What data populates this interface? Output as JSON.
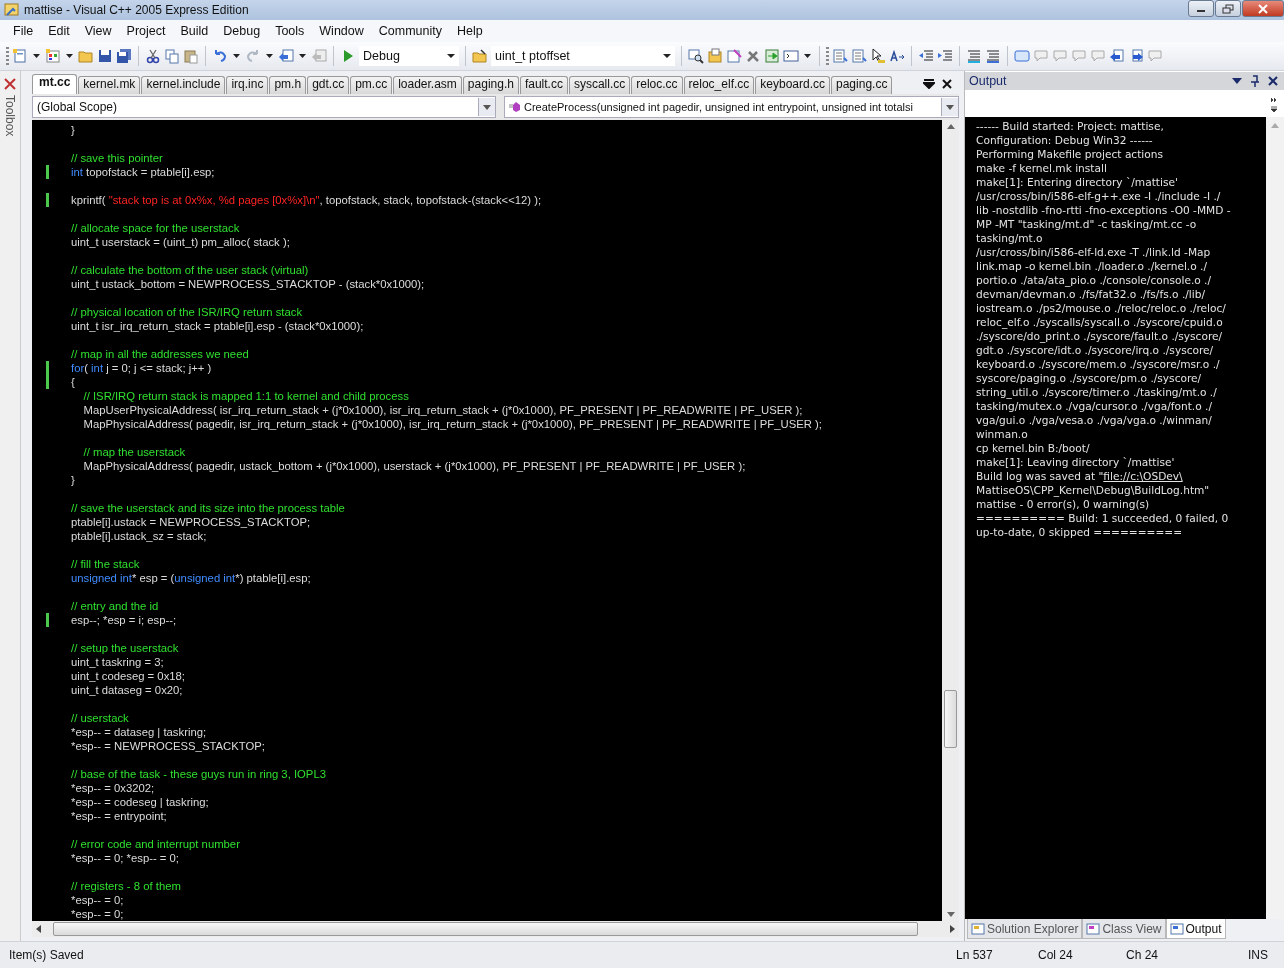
{
  "window": {
    "title": "mattise - Visual C++ 2005 Express Edition"
  },
  "menu": [
    "File",
    "Edit",
    "View",
    "Project",
    "Build",
    "Debug",
    "Tools",
    "Window",
    "Community",
    "Help"
  ],
  "toolbar": {
    "configuration": "Debug",
    "find_box": "uint_t ptoffset"
  },
  "toolbox": {
    "label": "Toolbox"
  },
  "tabs": [
    {
      "label": "mt.cc",
      "selected": true
    },
    {
      "label": "kernel.mk",
      "selected": false
    },
    {
      "label": "kernel.include",
      "selected": false
    },
    {
      "label": "irq.inc",
      "selected": false
    },
    {
      "label": "pm.h",
      "selected": false
    },
    {
      "label": "gdt.cc",
      "selected": false
    },
    {
      "label": "pm.cc",
      "selected": false
    },
    {
      "label": "loader.asm",
      "selected": false
    },
    {
      "label": "paging.h",
      "selected": false
    },
    {
      "label": "fault.cc",
      "selected": false
    },
    {
      "label": "syscall.cc",
      "selected": false
    },
    {
      "label": "reloc.cc",
      "selected": false
    },
    {
      "label": "reloc_elf.cc",
      "selected": false
    },
    {
      "label": "keyboard.cc",
      "selected": false
    },
    {
      "label": "paging.cc",
      "selected": false
    }
  ],
  "scope": {
    "left": "(Global Scope)",
    "right": "CreateProcess(unsigned int pagedir, unsigned int entrypoint, unsigned int totalsi"
  },
  "code": [
    {
      "kind": "code",
      "changed": false,
      "tokens": [
        {
          "kind": "plain",
          "text": "}"
        }
      ]
    },
    {
      "kind": "blank",
      "changed": false
    },
    {
      "kind": "code",
      "changed": false,
      "tokens": [
        {
          "kind": "comment",
          "text": "// save this pointer"
        }
      ]
    },
    {
      "kind": "code",
      "changed": true,
      "tokens": [
        {
          "kind": "keyword",
          "text": "int"
        },
        {
          "kind": "plain",
          "text": " topofstack = ptable[i].esp;"
        }
      ]
    },
    {
      "kind": "blank",
      "changed": false
    },
    {
      "kind": "code",
      "changed": true,
      "tokens": [
        {
          "kind": "plain",
          "text": "kprintf( "
        },
        {
          "kind": "string",
          "text": "\"stack top is at 0x%x, %d pages [0x%x]\\n\""
        },
        {
          "kind": "plain",
          "text": ", topofstack, stack, topofstack-(stack<<12) );"
        }
      ]
    },
    {
      "kind": "blank",
      "changed": false
    },
    {
      "kind": "code",
      "changed": false,
      "tokens": [
        {
          "kind": "comment",
          "text": "// allocate space for the userstack"
        }
      ]
    },
    {
      "kind": "code",
      "changed": false,
      "tokens": [
        {
          "kind": "plain",
          "text": "uint_t userstack = (uint_t) pm_alloc( stack );"
        }
      ]
    },
    {
      "kind": "blank",
      "changed": false
    },
    {
      "kind": "code",
      "changed": false,
      "tokens": [
        {
          "kind": "comment",
          "text": "// calculate the bottom of the user stack (virtual)"
        }
      ]
    },
    {
      "kind": "code",
      "changed": false,
      "tokens": [
        {
          "kind": "plain",
          "text": "uint_t ustack_bottom = NEWPROCESS_STACKTOP - (stack*0x1000);"
        }
      ]
    },
    {
      "kind": "blank",
      "changed": false
    },
    {
      "kind": "code",
      "changed": false,
      "tokens": [
        {
          "kind": "comment",
          "text": "// physical location of the ISR/IRQ return stack"
        }
      ]
    },
    {
      "kind": "code",
      "changed": false,
      "tokens": [
        {
          "kind": "plain",
          "text": "uint_t isr_irq_return_stack = ptable[i].esp - (stack*0x1000);"
        }
      ]
    },
    {
      "kind": "blank",
      "changed": false
    },
    {
      "kind": "code",
      "changed": false,
      "tokens": [
        {
          "kind": "comment",
          "text": "// map in all the addresses we need"
        }
      ]
    },
    {
      "kind": "code",
      "changed": true,
      "tokens": [
        {
          "kind": "keyword",
          "text": "for"
        },
        {
          "kind": "plain",
          "text": "( "
        },
        {
          "kind": "keyword",
          "text": "int"
        },
        {
          "kind": "plain",
          "text": " j = 0; j <= stack; j++ )"
        }
      ]
    },
    {
      "kind": "code",
      "changed": true,
      "tokens": [
        {
          "kind": "plain",
          "text": "{"
        }
      ]
    },
    {
      "kind": "code",
      "changed": false,
      "tokens": [
        {
          "kind": "comment",
          "text": "    // ISR/IRQ return stack is mapped 1:1 to kernel and child process"
        }
      ]
    },
    {
      "kind": "code",
      "changed": false,
      "tokens": [
        {
          "kind": "plain",
          "text": "    MapUserPhysicalAddress( isr_irq_return_stack + (j*0x1000), isr_irq_return_stack + (j*0x1000), PF_PRESENT | PF_READWRITE | PF_USER );"
        }
      ]
    },
    {
      "kind": "code",
      "changed": false,
      "tokens": [
        {
          "kind": "plain",
          "text": "    MapPhysicalAddress( pagedir, isr_irq_return_stack + (j*0x1000), isr_irq_return_stack + (j*0x1000), PF_PRESENT | PF_READWRITE | PF_USER );"
        }
      ]
    },
    {
      "kind": "blank",
      "changed": false
    },
    {
      "kind": "code",
      "changed": false,
      "tokens": [
        {
          "kind": "comment",
          "text": "    // map the userstack"
        }
      ]
    },
    {
      "kind": "code",
      "changed": false,
      "tokens": [
        {
          "kind": "plain",
          "text": "    MapPhysicalAddress( pagedir, ustack_bottom + (j*0x1000), userstack + (j*0x1000), PF_PRESENT | PF_READWRITE | PF_USER );"
        }
      ]
    },
    {
      "kind": "code",
      "changed": false,
      "tokens": [
        {
          "kind": "plain",
          "text": "}"
        }
      ]
    },
    {
      "kind": "blank",
      "changed": false
    },
    {
      "kind": "code",
      "changed": false,
      "tokens": [
        {
          "kind": "comment",
          "text": "// save the userstack and its size into the process table"
        }
      ]
    },
    {
      "kind": "code",
      "changed": false,
      "tokens": [
        {
          "kind": "plain",
          "text": "ptable[i].ustack = NEWPROCESS_STACKTOP;"
        }
      ]
    },
    {
      "kind": "code",
      "changed": false,
      "tokens": [
        {
          "kind": "plain",
          "text": "ptable[i].ustack_sz = stack;"
        }
      ]
    },
    {
      "kind": "blank",
      "changed": false
    },
    {
      "kind": "code",
      "changed": false,
      "tokens": [
        {
          "kind": "comment",
          "text": "// fill the stack"
        }
      ]
    },
    {
      "kind": "code",
      "changed": false,
      "tokens": [
        {
          "kind": "keyword",
          "text": "unsigned int"
        },
        {
          "kind": "plain",
          "text": "* esp = ("
        },
        {
          "kind": "keyword",
          "text": "unsigned int"
        },
        {
          "kind": "plain",
          "text": "*) ptable[i].esp;"
        }
      ]
    },
    {
      "kind": "blank",
      "changed": false
    },
    {
      "kind": "code",
      "changed": false,
      "tokens": [
        {
          "kind": "comment",
          "text": "// entry and the id"
        }
      ]
    },
    {
      "kind": "code",
      "changed": true,
      "tokens": [
        {
          "kind": "plain",
          "text": "esp--; *esp = i; esp--;"
        }
      ]
    },
    {
      "kind": "blank",
      "changed": false
    },
    {
      "kind": "code",
      "changed": false,
      "tokens": [
        {
          "kind": "comment",
          "text": "// setup the userstack"
        }
      ]
    },
    {
      "kind": "code",
      "changed": false,
      "tokens": [
        {
          "kind": "plain",
          "text": "uint_t taskring = 3;"
        }
      ]
    },
    {
      "kind": "code",
      "changed": false,
      "tokens": [
        {
          "kind": "plain",
          "text": "uint_t codeseg = 0x18;"
        }
      ]
    },
    {
      "kind": "code",
      "changed": false,
      "tokens": [
        {
          "kind": "plain",
          "text": "uint_t dataseg = 0x20;"
        }
      ]
    },
    {
      "kind": "blank",
      "changed": false
    },
    {
      "kind": "code",
      "changed": false,
      "tokens": [
        {
          "kind": "comment",
          "text": "// userstack"
        }
      ]
    },
    {
      "kind": "code",
      "changed": false,
      "tokens": [
        {
          "kind": "plain",
          "text": "*esp-- = dataseg | taskring;"
        }
      ]
    },
    {
      "kind": "code",
      "changed": false,
      "tokens": [
        {
          "kind": "plain",
          "text": "*esp-- = NEWPROCESS_STACKTOP;"
        }
      ]
    },
    {
      "kind": "blank",
      "changed": false
    },
    {
      "kind": "code",
      "changed": false,
      "tokens": [
        {
          "kind": "comment",
          "text": "// base of the task - these guys run in ring 3, IOPL3"
        }
      ]
    },
    {
      "kind": "code",
      "changed": false,
      "tokens": [
        {
          "kind": "plain",
          "text": "*esp-- = 0x3202;"
        }
      ]
    },
    {
      "kind": "code",
      "changed": false,
      "tokens": [
        {
          "kind": "plain",
          "text": "*esp-- = codeseg | taskring;"
        }
      ]
    },
    {
      "kind": "code",
      "changed": false,
      "tokens": [
        {
          "kind": "plain",
          "text": "*esp-- = entrypoint;"
        }
      ]
    },
    {
      "kind": "blank",
      "changed": false
    },
    {
      "kind": "code",
      "changed": false,
      "tokens": [
        {
          "kind": "comment",
          "text": "// error code and interrupt number"
        }
      ]
    },
    {
      "kind": "code",
      "changed": false,
      "tokens": [
        {
          "kind": "plain",
          "text": "*esp-- = 0; *esp-- = 0;"
        }
      ]
    },
    {
      "kind": "blank",
      "changed": false
    },
    {
      "kind": "code",
      "changed": false,
      "tokens": [
        {
          "kind": "comment",
          "text": "// registers - 8 of them"
        }
      ]
    },
    {
      "kind": "code",
      "changed": false,
      "tokens": [
        {
          "kind": "plain",
          "text": "*esp-- = 0;"
        }
      ]
    },
    {
      "kind": "code",
      "changed": false,
      "tokens": [
        {
          "kind": "plain",
          "text": "*esp-- = 0;"
        }
      ]
    }
  ],
  "output": {
    "title": "Output",
    "lines": [
      {
        "text": "------ Build started: Project: mattise,"
      },
      {
        "text": "Configuration: Debug Win32 ------"
      },
      {
        "text": "Performing Makefile project actions"
      },
      {
        "text": "make -f kernel.mk install"
      },
      {
        "text": "make[1]: Entering directory `/mattise'"
      },
      {
        "text": "/usr/cross/bin/i586-elf-g++.exe -I ./include -I ./"
      },
      {
        "text": "lib -nostdlib -fno-rtti -fno-exceptions -O0 -MMD -"
      },
      {
        "text": "MP -MT \"tasking/mt.d\" -c tasking/mt.cc -o"
      },
      {
        "text": "tasking/mt.o"
      },
      {
        "text": "/usr/cross/bin/i586-elf-ld.exe -T ./link.ld -Map"
      },
      {
        "text": "link.map -o kernel.bin ./loader.o ./kernel.o ./"
      },
      {
        "text": "portio.o ./ata/ata_pio.o ./console/console.o ./"
      },
      {
        "text": "devman/devman.o ./fs/fat32.o ./fs/fs.o ./lib/"
      },
      {
        "text": "iostream.o ./ps2/mouse.o ./reloc/reloc.o ./reloc/"
      },
      {
        "text": "reloc_elf.o ./syscalls/syscall.o ./syscore/cpuid.o"
      },
      {
        "text": "./syscore/do_print.o ./syscore/fault.o ./syscore/"
      },
      {
        "text": "gdt.o ./syscore/idt.o ./syscore/irq.o ./syscore/"
      },
      {
        "text": "keyboard.o ./syscore/mem.o ./syscore/msr.o ./"
      },
      {
        "text": "syscore/paging.o ./syscore/pm.o ./syscore/"
      },
      {
        "text": "string_util.o ./syscore/timer.o ./tasking/mt.o ./"
      },
      {
        "text": "tasking/mutex.o ./vga/cursor.o ./vga/font.o ./"
      },
      {
        "text": "vga/gui.o ./vga/vesa.o ./vga/vga.o ./winman/"
      },
      {
        "text": "winman.o"
      },
      {
        "text": "cp kernel.bin B:/boot/"
      },
      {
        "text": "make[1]: Leaving directory `/mattise'"
      },
      {
        "text": "Build log was saved at \"",
        "link": "file://c:\\OSDev\\"
      },
      {
        "text": "MattiseOS\\CPP_Kernel\\Debug\\BuildLog.htm\""
      },
      {
        "text": "mattise - 0 error(s), 0 warning(s)"
      },
      {
        "text": "========== Build: 1 succeeded, 0 failed, 0"
      },
      {
        "text": "up-to-date, 0 skipped =========="
      }
    ]
  },
  "panel_tabs": [
    {
      "label": "Solution Explorer",
      "selected": false
    },
    {
      "label": "Class View",
      "selected": false
    },
    {
      "label": "Output",
      "selected": true
    }
  ],
  "status_bar": {
    "message": "Item(s) Saved",
    "line": "Ln 537",
    "column": "Col 24",
    "char": "Ch 24",
    "mode": "INS"
  }
}
